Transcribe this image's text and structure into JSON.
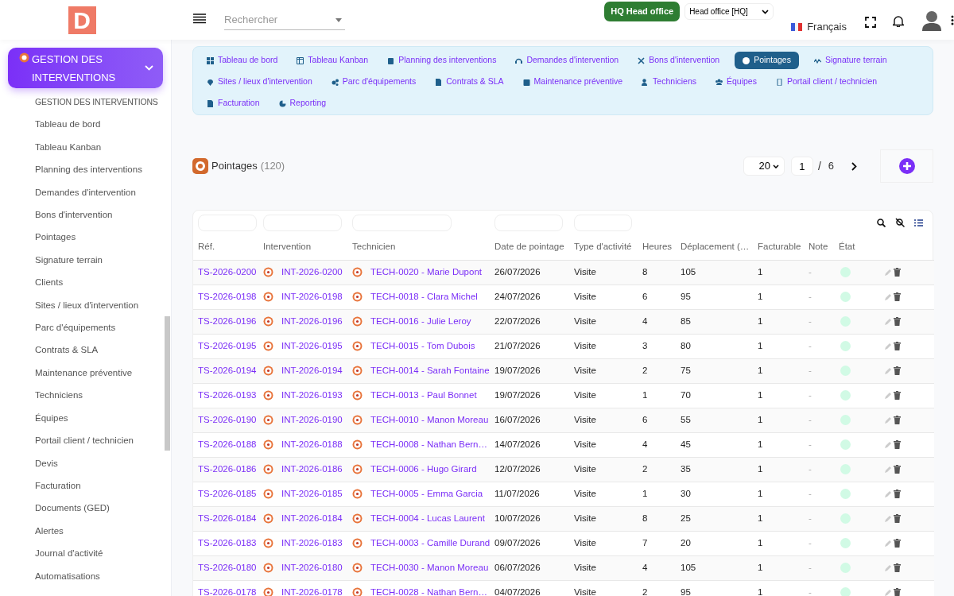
{
  "header": {
    "logo": "D",
    "search": {
      "placeholder": "Rechercher"
    },
    "office_badge": "HQ Head office",
    "office_select": "Head office [HQ]",
    "language": "Français"
  },
  "sidebar": {
    "section": {
      "title": "GESTION DES INTERVENTIONS",
      "expanded": true
    },
    "items": [
      "GESTION DES INTERVENTIONS",
      "Tableau de bord",
      "Tableau Kanban",
      "Planning des interventions",
      "Demandes d'intervention",
      "Bons d'intervention",
      "Pointages",
      "Signature terrain",
      "Clients",
      "Sites / lieux d'intervention",
      "Parc d'équipements",
      "Contrats & SLA",
      "Maintenance préventive",
      "Techniciens",
      "Équipes",
      "Portail client / technicien",
      "Devis",
      "Facturation",
      "Documents (GED)",
      "Alertes",
      "Journal d'activité",
      "Automatisations"
    ]
  },
  "subnav": [
    {
      "label": "Tableau de bord",
      "selected": false
    },
    {
      "label": "Tableau Kanban",
      "selected": false
    },
    {
      "label": "Planning des interventions",
      "selected": false
    },
    {
      "label": "Demandes d'intervention",
      "selected": false
    },
    {
      "label": "Bons d'intervention",
      "selected": false
    },
    {
      "label": "Pointages",
      "selected": true
    },
    {
      "label": "Signature terrain",
      "selected": false
    },
    {
      "label": "Sites / lieux d'intervention",
      "selected": false
    },
    {
      "label": "Parc d'équipements",
      "selected": false
    },
    {
      "label": "Contrats & SLA",
      "selected": false
    },
    {
      "label": "Maintenance préventive",
      "selected": false
    },
    {
      "label": "Techniciens",
      "selected": false
    },
    {
      "label": "Équipes",
      "selected": false
    },
    {
      "label": "Portail client / technicien",
      "selected": false
    },
    {
      "label": "Facturation",
      "selected": false
    },
    {
      "label": "Reporting",
      "selected": false
    }
  ],
  "page": {
    "title": "Pointages",
    "count": "(120)",
    "page_size": "20",
    "page": "1",
    "separator": "/",
    "total_pages": "6"
  },
  "table": {
    "columns": [
      "Réf.",
      "Intervention",
      "Technicien",
      "Date de pointage",
      "Type d'activité",
      "Heures",
      "Déplacement (…",
      "Facturable",
      "Note",
      "État"
    ],
    "rows": [
      {
        "ref": "TS-2026-0200",
        "intervention": "INT-2026-0200",
        "technician": "TECH-0020 - Marie Dupont",
        "date": "26/07/2026",
        "type": "Visite",
        "hours": "8",
        "travel": "105",
        "billable": "1",
        "note": "-",
        "color": "#d1fae5"
      },
      {
        "ref": "TS-2026-0198",
        "intervention": "INT-2026-0198",
        "technician": "TECH-0018 - Clara Michel",
        "date": "24/07/2026",
        "type": "Visite",
        "hours": "6",
        "travel": "95",
        "billable": "1",
        "note": "-",
        "color": "#d1fae5"
      },
      {
        "ref": "TS-2026-0196",
        "intervention": "INT-2026-0196",
        "technician": "TECH-0016 - Julie Leroy",
        "date": "22/07/2026",
        "type": "Visite",
        "hours": "4",
        "travel": "85",
        "billable": "1",
        "note": "-",
        "color": "#d1fae5"
      },
      {
        "ref": "TS-2026-0195",
        "intervention": "INT-2026-0195",
        "technician": "TECH-0015 - Tom Dubois",
        "date": "21/07/2026",
        "type": "Visite",
        "hours": "3",
        "travel": "80",
        "billable": "1",
        "note": "-",
        "color": "#d1fae5"
      },
      {
        "ref": "TS-2026-0194",
        "intervention": "INT-2026-0194",
        "technician": "TECH-0014 - Sarah Fontaine",
        "date": "19/07/2026",
        "type": "Visite",
        "hours": "2",
        "travel": "75",
        "billable": "1",
        "note": "-",
        "color": "#d1fae5"
      },
      {
        "ref": "TS-2026-0193",
        "intervention": "INT-2026-0193",
        "technician": "TECH-0013 - Paul Bonnet",
        "date": "19/07/2026",
        "type": "Visite",
        "hours": "1",
        "travel": "70",
        "billable": "1",
        "note": "-",
        "color": "#d1fae5"
      },
      {
        "ref": "TS-2026-0190",
        "intervention": "INT-2026-0190",
        "technician": "TECH-0010 - Manon Moreau",
        "date": "16/07/2026",
        "type": "Visite",
        "hours": "6",
        "travel": "55",
        "billable": "1",
        "note": "-",
        "color": "#d1fae5"
      },
      {
        "ref": "TS-2026-0188",
        "intervention": "INT-2026-0188",
        "technician": "TECH-0008 - Nathan Bern…",
        "date": "14/07/2026",
        "type": "Visite",
        "hours": "4",
        "travel": "45",
        "billable": "1",
        "note": "-",
        "color": "#d1fae5"
      },
      {
        "ref": "TS-2026-0186",
        "intervention": "INT-2026-0186",
        "technician": "TECH-0006 - Hugo Girard",
        "date": "12/07/2026",
        "type": "Visite",
        "hours": "2",
        "travel": "35",
        "billable": "1",
        "note": "-",
        "color": "#d1fae5"
      },
      {
        "ref": "TS-2026-0185",
        "intervention": "INT-2026-0185",
        "technician": "TECH-0005 - Emma Garcia",
        "date": "11/07/2026",
        "type": "Visite",
        "hours": "1",
        "travel": "30",
        "billable": "1",
        "note": "-",
        "color": "#d1fae5"
      },
      {
        "ref": "TS-2026-0184",
        "intervention": "INT-2026-0184",
        "technician": "TECH-0004 - Lucas Laurent",
        "date": "10/07/2026",
        "type": "Visite",
        "hours": "8",
        "travel": "25",
        "billable": "1",
        "note": "-",
        "color": "#d1fae5"
      },
      {
        "ref": "TS-2026-0183",
        "intervention": "INT-2026-0183",
        "technician": "TECH-0003 - Camille Durand",
        "date": "09/07/2026",
        "type": "Visite",
        "hours": "7",
        "travel": "20",
        "billable": "1",
        "note": "-",
        "color": "#d1fae5"
      },
      {
        "ref": "TS-2026-0180",
        "intervention": "INT-2026-0180",
        "technician": "TECH-0030 - Manon Moreau",
        "date": "06/07/2026",
        "type": "Visite",
        "hours": "4",
        "travel": "105",
        "billable": "1",
        "note": "-",
        "color": "#d1fae5"
      },
      {
        "ref": "TS-2026-0178",
        "intervention": "INT-2026-0178",
        "technician": "TECH-0028 - Nathan Bern…",
        "date": "04/07/2026",
        "type": "Visite",
        "hours": "2",
        "travel": "95",
        "billable": "1",
        "note": "-",
        "color": "#d1fae5"
      }
    ]
  }
}
